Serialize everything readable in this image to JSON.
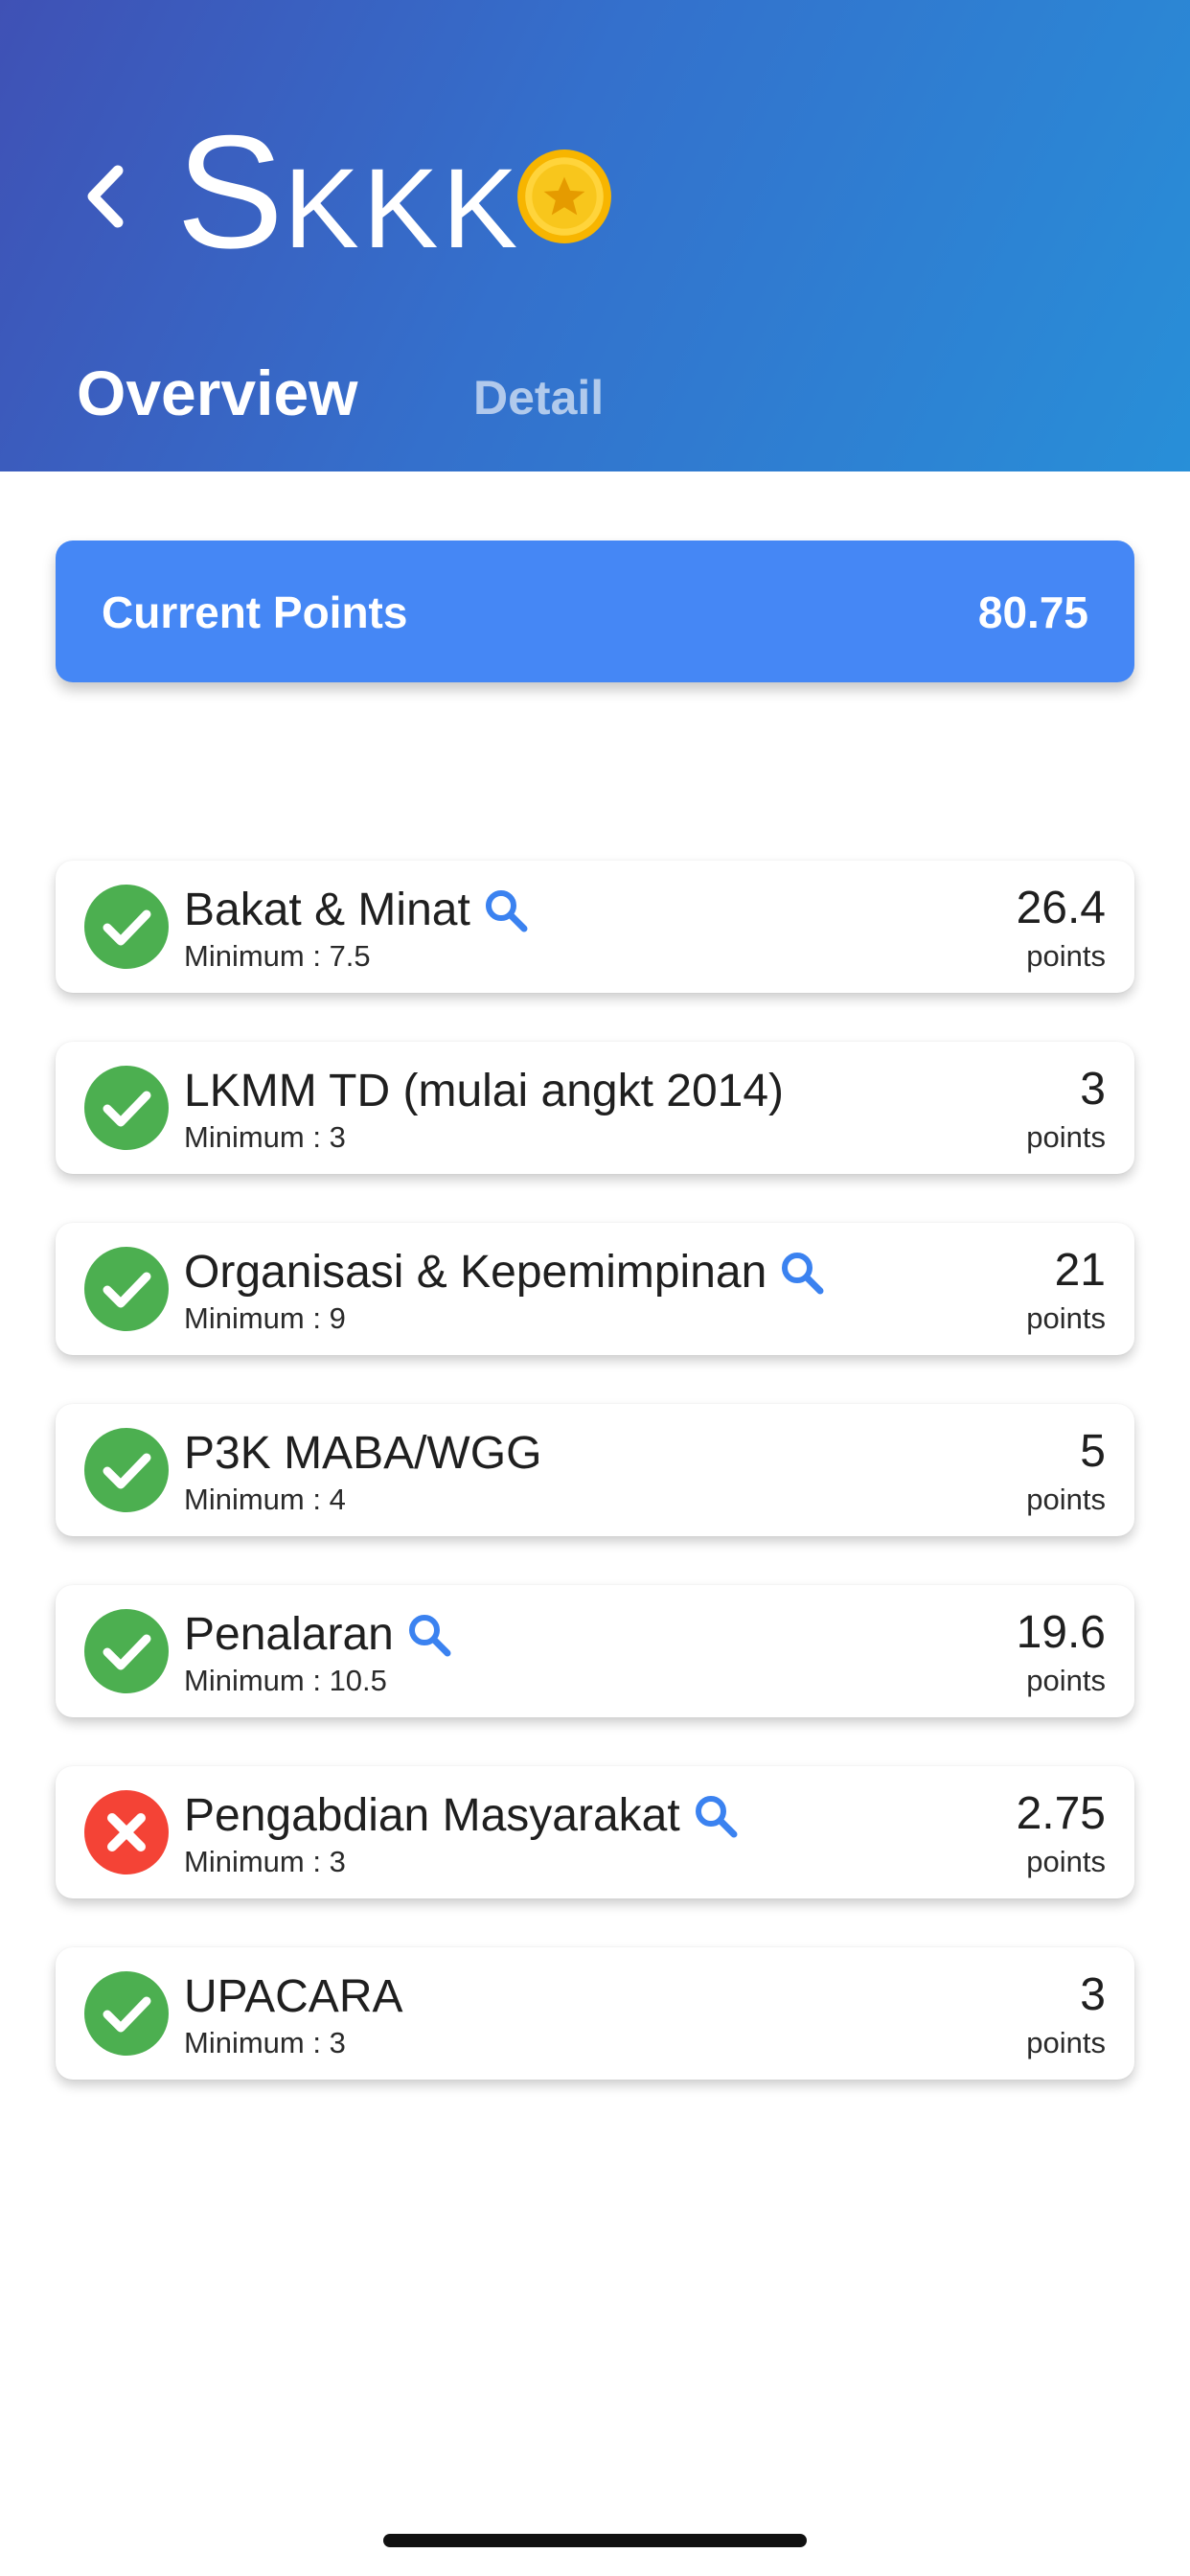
{
  "header": {
    "title_cap": "S",
    "title_rest": "KKK",
    "icons": {
      "back": "chevron-left-icon",
      "coin": "star-coin-icon"
    },
    "colors": {
      "gradient_start": "#3f51b5",
      "gradient_end": "#288fd8"
    }
  },
  "tabs": [
    {
      "label": "Overview",
      "active": true
    },
    {
      "label": "Detail",
      "active": false
    }
  ],
  "current_points": {
    "label": "Current Points",
    "value": "80.75",
    "color": "#4587f5"
  },
  "items": [
    {
      "name": "Bakat & Minat",
      "minimum": "Minimum : 7.5",
      "value": "26.4",
      "unit": "points",
      "status": "passed",
      "has_search": true
    },
    {
      "name": "LKMM TD (mulai angkt 2014)",
      "minimum": "Minimum : 3",
      "value": "3",
      "unit": "points",
      "status": "passed",
      "has_search": false
    },
    {
      "name": "Organisasi & Kepemimpinan",
      "minimum": "Minimum : 9",
      "value": "21",
      "unit": "points",
      "status": "passed",
      "has_search": true
    },
    {
      "name": "P3K MABA/WGG",
      "minimum": "Minimum : 4",
      "value": "5",
      "unit": "points",
      "status": "passed",
      "has_search": false
    },
    {
      "name": "Penalaran",
      "minimum": "Minimum : 10.5",
      "value": "19.6",
      "unit": "points",
      "status": "passed",
      "has_search": true
    },
    {
      "name": "Pengabdian Masyarakat",
      "minimum": "Minimum : 3",
      "value": "2.75",
      "unit": "points",
      "status": "failed",
      "has_search": true
    },
    {
      "name": "UPACARA",
      "minimum": "Minimum : 3",
      "value": "3",
      "unit": "points",
      "status": "passed",
      "has_search": false
    }
  ],
  "status_colors": {
    "passed": "#4caf50",
    "failed": "#f44336",
    "search": "#3b82f0"
  }
}
